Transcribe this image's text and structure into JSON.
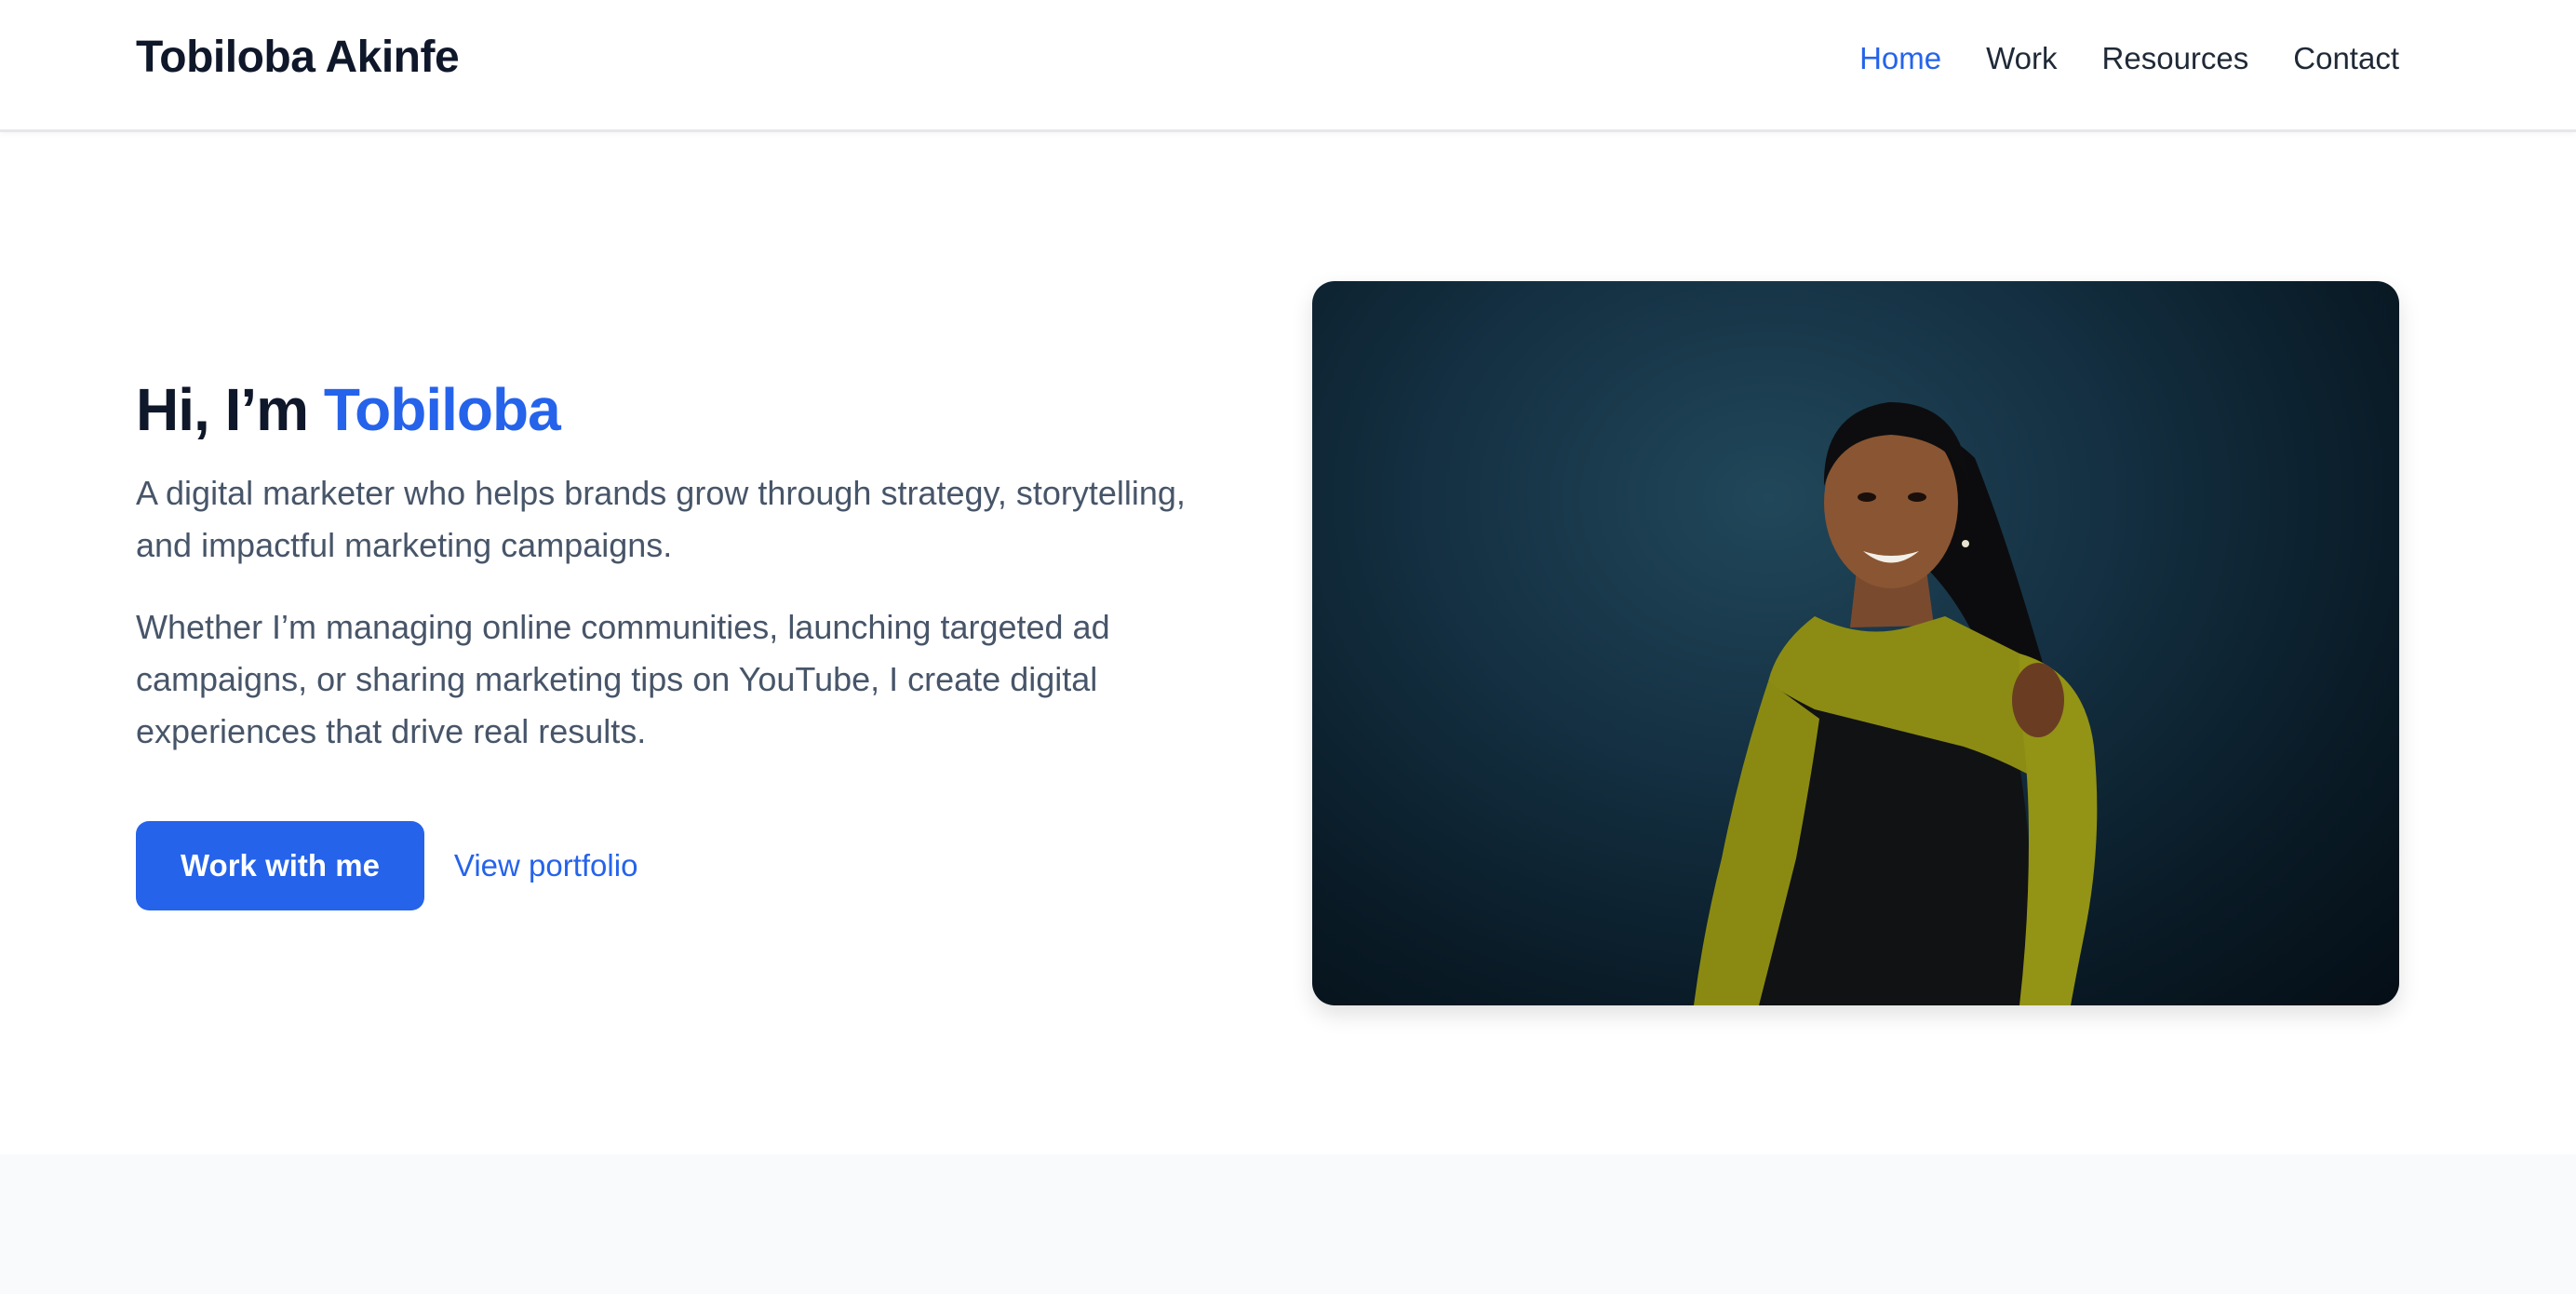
{
  "header": {
    "brand": "Tobiloba Akinfe",
    "nav": [
      {
        "label": "Home",
        "active": true
      },
      {
        "label": "Work",
        "active": false
      },
      {
        "label": "Resources",
        "active": false
      },
      {
        "label": "Contact",
        "active": false
      }
    ]
  },
  "hero": {
    "greeting": "Hi, I’m ",
    "name": "Tobiloba",
    "intro": "A digital marketer who helps brands grow through strategy, storytelling, and impactful marketing campaigns.",
    "details": "Whether I’m managing online communities, launching targeted ad campaigns, or sharing marketing tips on YouTube, I create digital experiences that drive real results.",
    "primary_button": "Work with me",
    "secondary_link": "View portfolio"
  },
  "colors": {
    "accent": "#2563eb",
    "text_dark": "#0f172a",
    "text_muted": "#475569"
  }
}
